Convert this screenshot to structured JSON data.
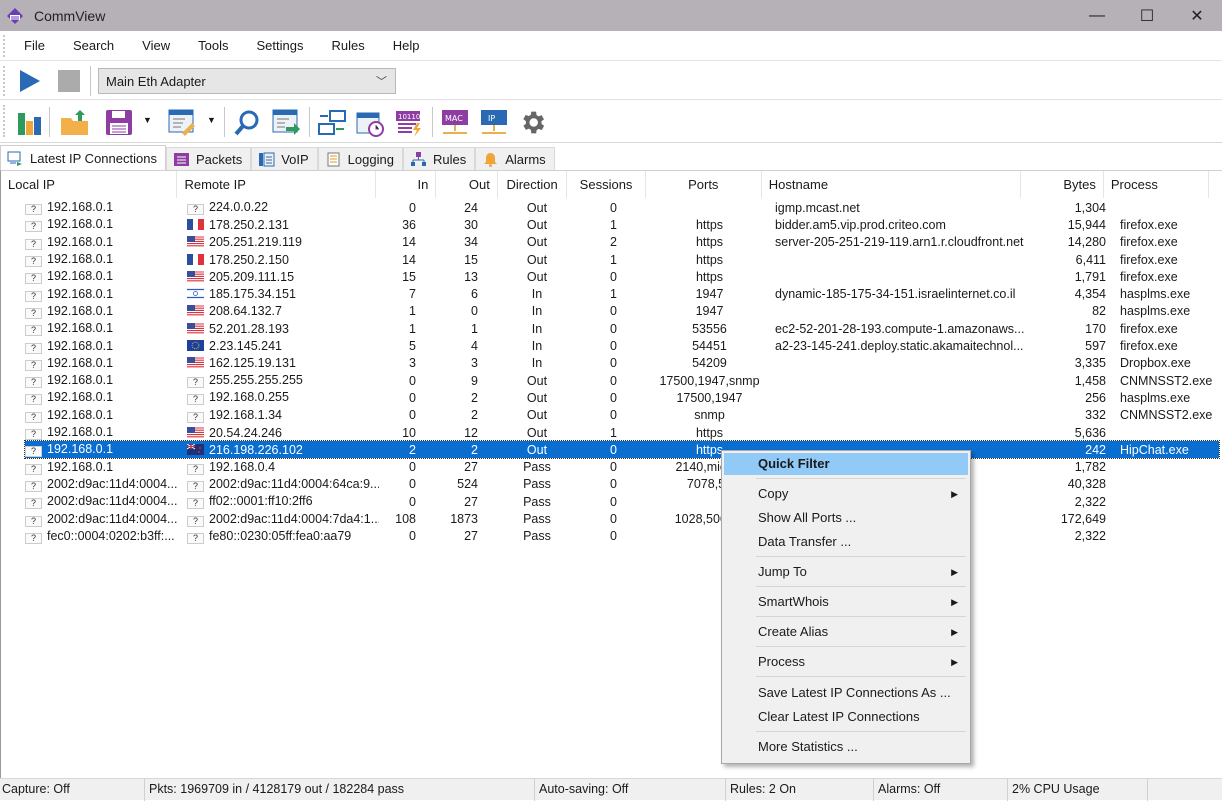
{
  "window": {
    "title": "CommView",
    "minimize": "—",
    "maximize": "☐",
    "close": "✕"
  },
  "menu": [
    "File",
    "Search",
    "View",
    "Tools",
    "Settings",
    "Rules",
    "Help"
  ],
  "capture_toolbar": {
    "adapter": "Main Eth Adapter"
  },
  "tabs": [
    {
      "label": "Latest IP Connections",
      "icon": "ip-connections-icon",
      "active": true
    },
    {
      "label": "Packets",
      "icon": "packets-icon"
    },
    {
      "label": "VoIP",
      "icon": "voip-icon"
    },
    {
      "label": "Logging",
      "icon": "logging-icon"
    },
    {
      "label": "Rules",
      "icon": "rules-icon"
    },
    {
      "label": "Alarms",
      "icon": "bell-icon"
    }
  ],
  "table": {
    "columns": [
      "Local IP",
      "Remote IP",
      "In",
      "Out",
      "Direction",
      "Sessions",
      "Ports",
      "Hostname",
      "Bytes",
      "Process"
    ],
    "rows": [
      {
        "local": "192.168.0.1",
        "flag": "unknown",
        "remote": "224.0.0.22",
        "in": "0",
        "out": "24",
        "dir": "Out",
        "sess": "0",
        "ports": "",
        "host": "igmp.mcast.net",
        "bytes": "1,304",
        "proc": ""
      },
      {
        "local": "192.168.0.1",
        "flag": "fr",
        "remote": "178.250.2.131",
        "in": "36",
        "out": "30",
        "dir": "Out",
        "sess": "1",
        "ports": "https",
        "host": "bidder.am5.vip.prod.criteo.com",
        "bytes": "15,944",
        "proc": "firefox.exe"
      },
      {
        "local": "192.168.0.1",
        "flag": "us",
        "remote": "205.251.219.119",
        "in": "14",
        "out": "34",
        "dir": "Out",
        "sess": "2",
        "ports": "https",
        "host": "server-205-251-219-119.arn1.r.cloudfront.net",
        "bytes": "14,280",
        "proc": "firefox.exe"
      },
      {
        "local": "192.168.0.1",
        "flag": "fr",
        "remote": "178.250.2.150",
        "in": "14",
        "out": "15",
        "dir": "Out",
        "sess": "1",
        "ports": "https",
        "host": "",
        "bytes": "6,411",
        "proc": "firefox.exe"
      },
      {
        "local": "192.168.0.1",
        "flag": "us",
        "remote": "205.209.111.15",
        "in": "15",
        "out": "13",
        "dir": "Out",
        "sess": "0",
        "ports": "https",
        "host": "",
        "bytes": "1,791",
        "proc": "firefox.exe"
      },
      {
        "local": "192.168.0.1",
        "flag": "il",
        "remote": "185.175.34.151",
        "in": "7",
        "out": "6",
        "dir": "In",
        "sess": "1",
        "ports": "1947",
        "host": "dynamic-185-175-34-151.israelinternet.co.il",
        "bytes": "4,354",
        "proc": "hasplms.exe"
      },
      {
        "local": "192.168.0.1",
        "flag": "us",
        "remote": "208.64.132.7",
        "in": "1",
        "out": "0",
        "dir": "In",
        "sess": "0",
        "ports": "1947",
        "host": "",
        "bytes": "82",
        "proc": "hasplms.exe"
      },
      {
        "local": "192.168.0.1",
        "flag": "us",
        "remote": "52.201.28.193",
        "in": "1",
        "out": "1",
        "dir": "In",
        "sess": "0",
        "ports": "53556",
        "host": "ec2-52-201-28-193.compute-1.amazonaws...",
        "bytes": "170",
        "proc": "firefox.exe"
      },
      {
        "local": "192.168.0.1",
        "flag": "eu",
        "remote": "2.23.145.241",
        "in": "5",
        "out": "4",
        "dir": "In",
        "sess": "0",
        "ports": "54451",
        "host": "a2-23-145-241.deploy.static.akamaitechnol...",
        "bytes": "597",
        "proc": "firefox.exe"
      },
      {
        "local": "192.168.0.1",
        "flag": "us",
        "remote": "162.125.19.131",
        "in": "3",
        "out": "3",
        "dir": "In",
        "sess": "0",
        "ports": "54209",
        "host": "",
        "bytes": "3,335",
        "proc": "Dropbox.exe"
      },
      {
        "local": "192.168.0.1",
        "flag": "unknown",
        "remote": "255.255.255.255",
        "in": "0",
        "out": "9",
        "dir": "Out",
        "sess": "0",
        "ports": "17500,1947,snmp",
        "host": "",
        "bytes": "1,458",
        "proc": "CNMNSST2.exe"
      },
      {
        "local": "192.168.0.1",
        "flag": "unknown",
        "remote": "192.168.0.255",
        "in": "0",
        "out": "2",
        "dir": "Out",
        "sess": "0",
        "ports": "17500,1947",
        "host": "",
        "bytes": "256",
        "proc": "hasplms.exe"
      },
      {
        "local": "192.168.0.1",
        "flag": "unknown",
        "remote": "192.168.1.34",
        "in": "0",
        "out": "2",
        "dir": "Out",
        "sess": "0",
        "ports": "snmp",
        "host": "",
        "bytes": "332",
        "proc": "CNMNSST2.exe"
      },
      {
        "local": "192.168.0.1",
        "flag": "us",
        "remote": "20.54.24.246",
        "in": "10",
        "out": "12",
        "dir": "Out",
        "sess": "1",
        "ports": "https",
        "host": "",
        "bytes": "5,636",
        "proc": ""
      },
      {
        "local": "192.168.0.1",
        "flag": "nz",
        "remote": "216.198.226.102",
        "in": "2",
        "out": "2",
        "dir": "Out",
        "sess": "0",
        "ports": "https",
        "host": "",
        "bytes": "242",
        "proc": "HipChat.exe",
        "selected": true
      },
      {
        "local": "192.168.0.1",
        "flag": "unknown",
        "remote": "192.168.0.4",
        "in": "0",
        "out": "27",
        "dir": "Pass",
        "sess": "0",
        "ports": "2140,micros",
        "host": "",
        "bytes": "1,782",
        "proc": ""
      },
      {
        "local": "2002:d9ac:11d4:0004...",
        "flag": "unknown",
        "remote": "2002:d9ac:11d4:0004:64ca:9...",
        "in": "0",
        "out": "524",
        "dir": "Pass",
        "sess": "0",
        "ports": "7078,51",
        "host": "",
        "bytes": "40,328",
        "proc": ""
      },
      {
        "local": "2002:d9ac:11d4:0004...",
        "flag": "unknown",
        "remote": "ff02::0001:ff10:2ff6",
        "in": "0",
        "out": "27",
        "dir": "Pass",
        "sess": "0",
        "ports": "",
        "host": "",
        "bytes": "2,322",
        "proc": ""
      },
      {
        "local": "2002:d9ac:11d4:0004...",
        "flag": "unknown",
        "remote": "2002:d9ac:11d4:0004:7da4:1...",
        "in": "108",
        "out": "1873",
        "dir": "Pass",
        "sess": "0",
        "ports": "1028,5060,5",
        "host": "",
        "bytes": "172,649",
        "proc": ""
      },
      {
        "local": "fec0::0004:0202:b3ff:...",
        "flag": "unknown",
        "remote": "fe80::0230:05ff:fea0:aa79",
        "in": "0",
        "out": "27",
        "dir": "Pass",
        "sess": "0",
        "ports": "",
        "host": "",
        "bytes": "2,322",
        "proc": ""
      }
    ]
  },
  "context_menu": {
    "items": [
      {
        "label": "Quick Filter",
        "highlighted": true
      },
      {
        "label": "Copy",
        "submenu": true
      },
      {
        "label": "Show All Ports ..."
      },
      {
        "label": "Data Transfer ..."
      },
      {
        "label": "Jump To",
        "submenu": true
      },
      {
        "label": "SmartWhois",
        "submenu": true
      },
      {
        "label": "Create Alias",
        "submenu": true
      },
      {
        "label": "Process",
        "submenu": true
      },
      {
        "label": "Save Latest IP Connections As ..."
      },
      {
        "label": "Clear Latest IP Connections"
      },
      {
        "label": "More Statistics ..."
      }
    ]
  },
  "status": {
    "capture": "Capture: Off",
    "packets": "Pkts: 1969709 in / 4128179 out / 182284 pass",
    "autosave": "Auto-saving: Off",
    "rules": "Rules: 2 On",
    "alarms": "Alarms: Off",
    "cpu": "2% CPU Usage"
  },
  "colors": {
    "selection": "#0a6ed1",
    "menu_highlight": "#91c9f7",
    "titlebar": "#b6b0b7"
  }
}
